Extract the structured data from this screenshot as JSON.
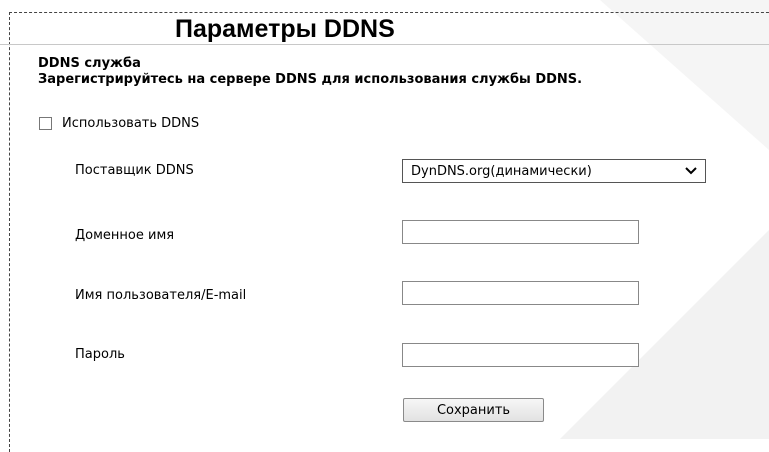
{
  "header": {
    "title": "Параметры DDNS"
  },
  "section": {
    "heading": "DDNS служба",
    "description": "Зарегистрируйтесь на сервере DDNS для использования службы DDNS."
  },
  "use_ddns": {
    "label": "Использовать DDNS",
    "checked": false
  },
  "fields": {
    "provider": {
      "label": "Поставщик DDNS",
      "selected": "DynDNS.org(динамически)"
    },
    "domain": {
      "label": "Доменное имя",
      "value": ""
    },
    "username": {
      "label": "Имя пользователя/E-mail",
      "value": ""
    },
    "password": {
      "label": "Пароль",
      "value": ""
    }
  },
  "actions": {
    "save_label": "Сохранить"
  },
  "icons": {
    "select_arrow": "chevron-down-icon"
  }
}
